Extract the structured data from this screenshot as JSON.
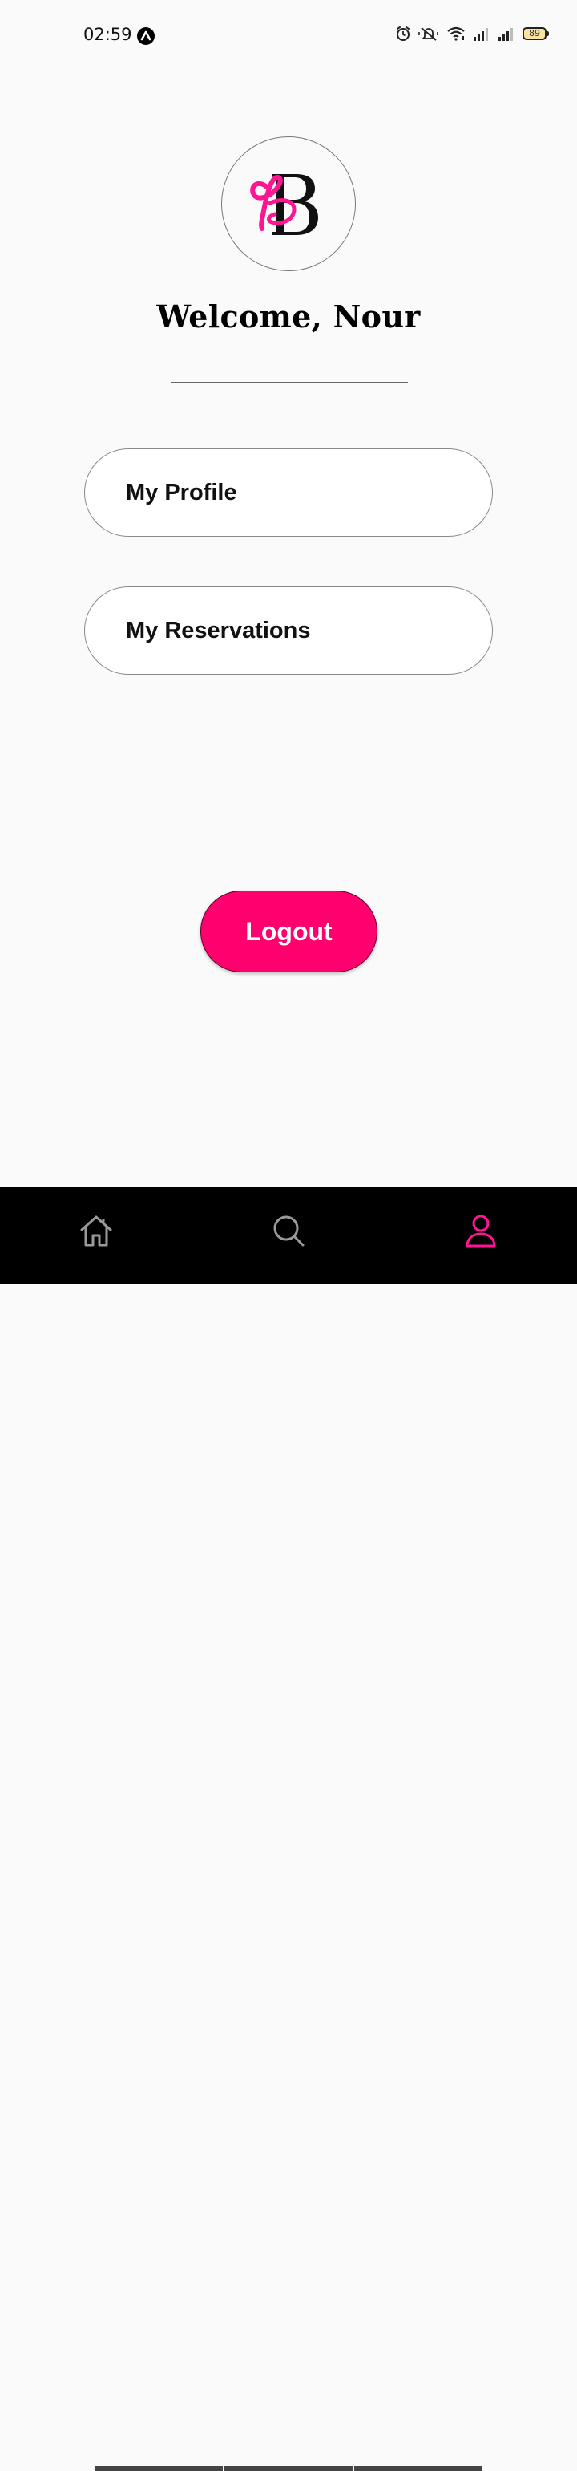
{
  "status_bar": {
    "time": "02:59",
    "battery": "89",
    "icons": [
      "app-icon",
      "alarm-icon",
      "mute-icon",
      "wifi-icon",
      "signal-icon",
      "signal-icon",
      "battery-icon"
    ]
  },
  "logo": {
    "name": "bb-logo-icon",
    "colors": {
      "accent": "#ff1493",
      "dark": "#111111"
    }
  },
  "welcome": {
    "title": "Welcome, Nour"
  },
  "menu": {
    "profile_label": "My Profile",
    "reservations_label": "My Reservations"
  },
  "logout": {
    "label": "Logout",
    "color": "#ff006e"
  },
  "bottom_nav": {
    "items": [
      {
        "icon": "home-icon",
        "active": false
      },
      {
        "icon": "search-icon",
        "active": false
      },
      {
        "icon": "user-icon",
        "active": true
      }
    ],
    "active_color": "#ff1493",
    "inactive_color": "#9a9a9a"
  }
}
